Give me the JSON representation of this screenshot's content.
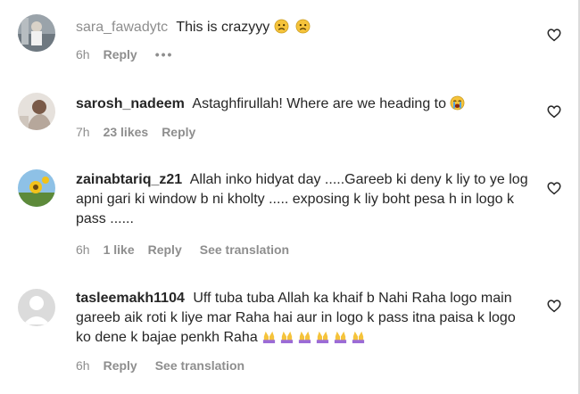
{
  "comments": [
    {
      "username": "sara_fawadytc",
      "text": "This is crazyyy",
      "emojis": [
        "worried-face",
        "worried-face"
      ],
      "time": "6h",
      "likes": "",
      "reply": "Reply",
      "more": "•••",
      "translation": ""
    },
    {
      "username": "sarosh_nadeem",
      "text": "Astaghfirullah! Where are we heading to",
      "emojis": [
        "crying-face"
      ],
      "time": "7h",
      "likes": "23 likes",
      "reply": "Reply",
      "translation": ""
    },
    {
      "username": "zainabtariq_z21",
      "text": "Allah inko hidyat day .....Gareeb ki deny k liy to ye log apni gari ki window b ni kholty ..... exposing k liy boht pesa h in logo k pass ......",
      "emojis": [],
      "time": "6h",
      "likes": "1 like",
      "reply": "Reply",
      "translation": "See translation"
    },
    {
      "username": "tasleemakh1104",
      "text": "Uff tuba tuba Allah ka khaif b Nahi Raha logo main gareeb aik roti k liye mar Raha hai aur in logo k pass itna paisa k logo ko dene k bajae penkh Raha",
      "emojis": [
        "pleading-hands",
        "pleading-hands",
        "pleading-hands",
        "pleading-hands",
        "pleading-hands",
        "pleading-hands"
      ],
      "time": "6h",
      "likes": "",
      "reply": "Reply",
      "translation": "See translation"
    }
  ],
  "colors": {
    "text": "#262626",
    "muted": "#8e8e8e",
    "emoji_yellow": "#f5c33b",
    "emoji_purple": "#9b6bd6"
  }
}
